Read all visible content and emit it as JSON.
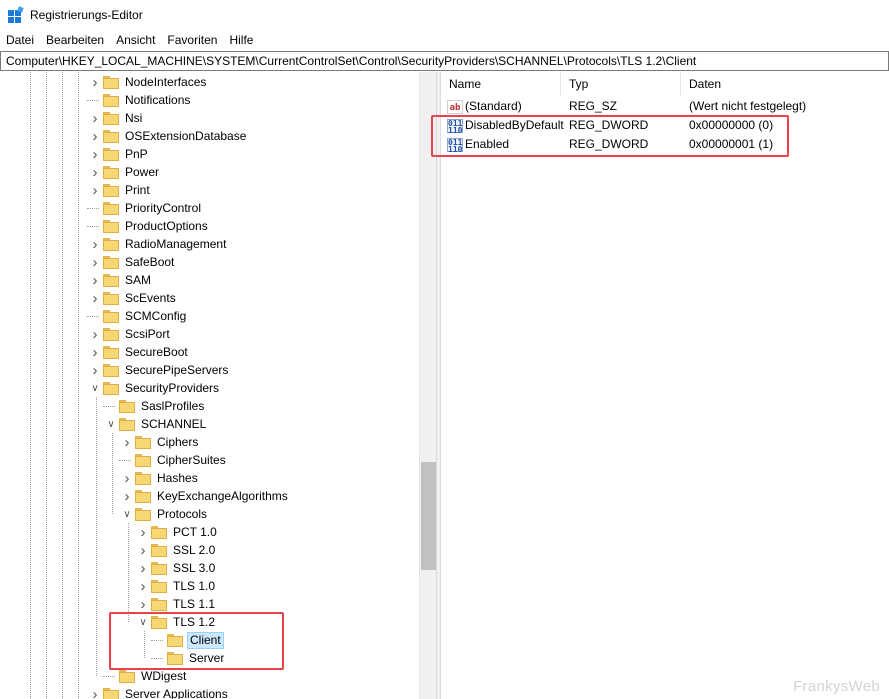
{
  "window": {
    "title": "Registrierungs-Editor"
  },
  "menu": [
    "Datei",
    "Bearbeiten",
    "Ansicht",
    "Favoriten",
    "Hilfe"
  ],
  "address": "Computer\\HKEY_LOCAL_MACHINE\\SYSTEM\\CurrentControlSet\\Control\\SecurityProviders\\SCHANNEL\\Protocols\\TLS 1.2\\Client",
  "tree": {
    "items": [
      {
        "label": "NodeInterfaces",
        "level": 0,
        "exp": "right"
      },
      {
        "label": "Notifications",
        "level": 0,
        "exp": "none"
      },
      {
        "label": "Nsi",
        "level": 0,
        "exp": "right"
      },
      {
        "label": "OSExtensionDatabase",
        "level": 0,
        "exp": "right"
      },
      {
        "label": "PnP",
        "level": 0,
        "exp": "right"
      },
      {
        "label": "Power",
        "level": 0,
        "exp": "right"
      },
      {
        "label": "Print",
        "level": 0,
        "exp": "right"
      },
      {
        "label": "PriorityControl",
        "level": 0,
        "exp": "none"
      },
      {
        "label": "ProductOptions",
        "level": 0,
        "exp": "none"
      },
      {
        "label": "RadioManagement",
        "level": 0,
        "exp": "right"
      },
      {
        "label": "SafeBoot",
        "level": 0,
        "exp": "right"
      },
      {
        "label": "SAM",
        "level": 0,
        "exp": "right"
      },
      {
        "label": "ScEvents",
        "level": 0,
        "exp": "right"
      },
      {
        "label": "SCMConfig",
        "level": 0,
        "exp": "none"
      },
      {
        "label": "ScsiPort",
        "level": 0,
        "exp": "right"
      },
      {
        "label": "SecureBoot",
        "level": 0,
        "exp": "right"
      },
      {
        "label": "SecurePipeServers",
        "level": 0,
        "exp": "right"
      },
      {
        "label": "SecurityProviders",
        "level": 0,
        "exp": "down"
      },
      {
        "label": "SaslProfiles",
        "level": 1,
        "exp": "none"
      },
      {
        "label": "SCHANNEL",
        "level": 1,
        "exp": "down"
      },
      {
        "label": "Ciphers",
        "level": 2,
        "exp": "right"
      },
      {
        "label": "CipherSuites",
        "level": 2,
        "exp": "none"
      },
      {
        "label": "Hashes",
        "level": 2,
        "exp": "right"
      },
      {
        "label": "KeyExchangeAlgorithms",
        "level": 2,
        "exp": "right"
      },
      {
        "label": "Protocols",
        "level": 2,
        "exp": "down"
      },
      {
        "label": "PCT 1.0",
        "level": 3,
        "exp": "right"
      },
      {
        "label": "SSL 2.0",
        "level": 3,
        "exp": "right"
      },
      {
        "label": "SSL 3.0",
        "level": 3,
        "exp": "right"
      },
      {
        "label": "TLS 1.0",
        "level": 3,
        "exp": "right"
      },
      {
        "label": "TLS 1.1",
        "level": 3,
        "exp": "right"
      },
      {
        "label": "TLS 1.2",
        "level": 3,
        "exp": "down"
      },
      {
        "label": "Client",
        "level": 4,
        "exp": "none",
        "selected": true
      },
      {
        "label": "Server",
        "level": 4,
        "exp": "none"
      },
      {
        "label": "WDigest",
        "level": 1,
        "exp": "none"
      },
      {
        "label": "Server Applications",
        "level": 0,
        "exp": "right"
      }
    ]
  },
  "list": {
    "columns": [
      "Name",
      "Typ",
      "Daten"
    ],
    "rows": [
      {
        "icon": "string-value-icon",
        "name": "(Standard)",
        "type": "REG_SZ",
        "data": "(Wert nicht festgelegt)"
      },
      {
        "icon": "dword-value-icon",
        "name": "DisabledByDefault",
        "type": "REG_DWORD",
        "data": "0x00000000 (0)"
      },
      {
        "icon": "dword-value-icon",
        "name": "Enabled",
        "type": "REG_DWORD",
        "data": "0x00000001 (1)"
      }
    ]
  },
  "icons": {
    "sz_glyph": "ab",
    "dword_glyph": "011\n110"
  },
  "colors": {
    "highlight": "#e8434b",
    "selection": "#cce8ff",
    "folder": "#f8d775"
  },
  "watermark": "FrankysWeb"
}
